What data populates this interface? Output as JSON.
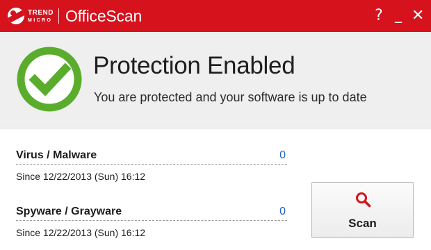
{
  "titlebar": {
    "brand_line1": "TREND",
    "brand_line2": "MICRO",
    "app_title": "OfficeScan",
    "help_glyph": "?",
    "minimize_glyph": "_",
    "close_glyph": "✕"
  },
  "status": {
    "title": "Protection Enabled",
    "subtitle": "You are protected and your software is up to date",
    "icon": "checkmark-circle-icon",
    "color": "#5aad2c"
  },
  "detections": [
    {
      "label": "Virus / Malware",
      "count": "0",
      "since": "Since 12/22/2013 (Sun) 16:12"
    },
    {
      "label": "Spyware / Grayware",
      "count": "0",
      "since": "Since 12/22/2013 (Sun) 16:12"
    }
  ],
  "scan_button": {
    "label": "Scan",
    "icon": "search-icon"
  },
  "colors": {
    "titlebar": "#d6121d",
    "banner": "#efefef",
    "count_link": "#1f5fbf",
    "check_green": "#5aad2c"
  }
}
